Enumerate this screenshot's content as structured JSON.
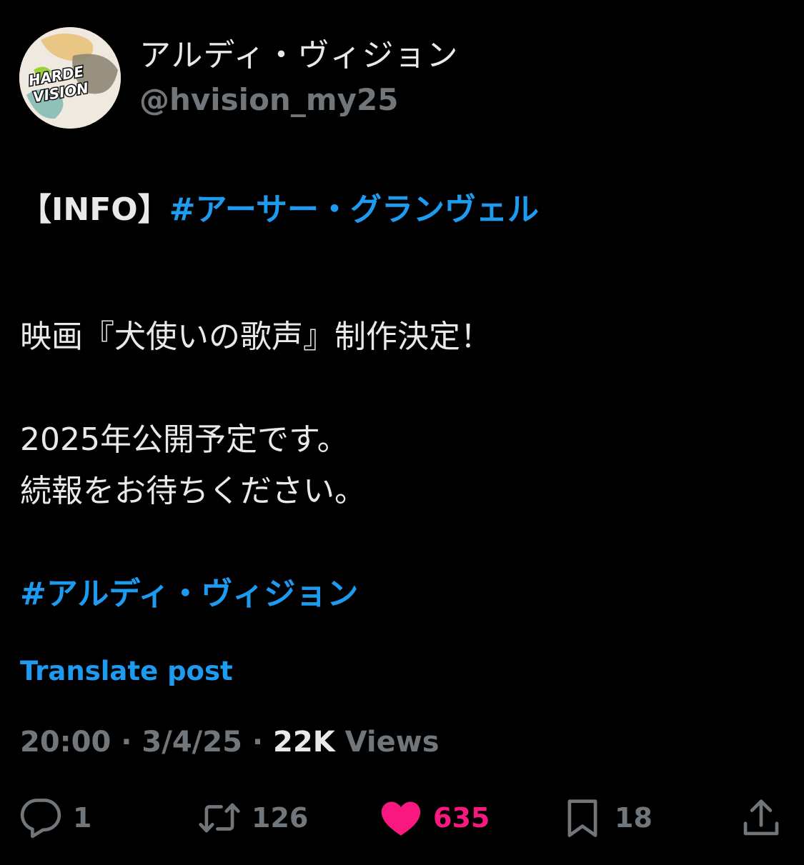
{
  "author": {
    "display_name": "アルディ・ヴィジョン",
    "handle": "@hvision_my25",
    "avatar_logo_text": "HARDE VISION"
  },
  "post": {
    "line1_prefix": "【INFO】",
    "line1_hashtag": "#アーサー・グランヴェル",
    "line2": "映画『犬使いの歌声』制作決定！",
    "line3": "2025年公開予定です。",
    "line4": "続報をお待ちください。",
    "hashtag2": "#アルディ・ヴィジョン"
  },
  "translate_label": "Translate post",
  "meta": {
    "time": "20:00",
    "separator": "·",
    "date": "3/4/25",
    "views_count": "22K",
    "views_label": "Views"
  },
  "actions": {
    "replies": "1",
    "reposts": "126",
    "likes": "635",
    "bookmarks": "18"
  },
  "colors": {
    "background": "#000000",
    "text": "#e7e9ea",
    "secondary": "#71767b",
    "link": "#1d9bf0",
    "like": "#f91880"
  },
  "icons": [
    "reply-icon",
    "repost-icon",
    "like-icon",
    "bookmark-icon",
    "share-icon"
  ]
}
